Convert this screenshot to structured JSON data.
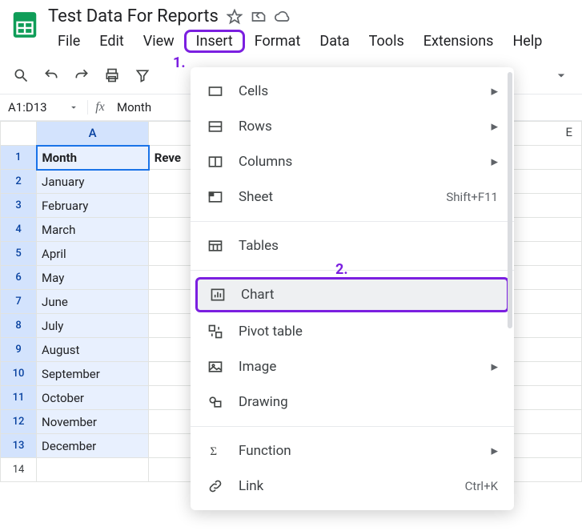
{
  "doc": {
    "title": "Test Data For Reports"
  },
  "menubar": [
    "File",
    "Edit",
    "View",
    "Insert",
    "Format",
    "Data",
    "Tools",
    "Extensions",
    "Help"
  ],
  "active_menu_index": 3,
  "namebox": "A1:D13",
  "formula": "Month",
  "columns": {
    "A": "A",
    "B_truncated": "Reve",
    "E": "E"
  },
  "rows_header": [
    "1",
    "2",
    "3",
    "4",
    "5",
    "6",
    "7",
    "8",
    "9",
    "10",
    "11",
    "12",
    "13",
    "14"
  ],
  "cells": {
    "A": [
      "Month",
      "January",
      "February",
      "March",
      "April",
      "May",
      "June",
      "July",
      "August",
      "September",
      "October",
      "November",
      "December",
      ""
    ],
    "B_visible_header": "Reve"
  },
  "insert_menu": {
    "group1": [
      {
        "icon": "cells",
        "label": "Cells",
        "submenu": true
      },
      {
        "icon": "rows",
        "label": "Rows",
        "submenu": true
      },
      {
        "icon": "columns",
        "label": "Columns",
        "submenu": true
      },
      {
        "icon": "sheet",
        "label": "Sheet",
        "shortcut": "Shift+F11"
      }
    ],
    "group2": [
      {
        "icon": "tables",
        "label": "Tables"
      }
    ],
    "group3": [
      {
        "icon": "chart",
        "label": "Chart",
        "highlight": true
      },
      {
        "icon": "pivot",
        "label": "Pivot table"
      },
      {
        "icon": "image",
        "label": "Image",
        "submenu": true
      },
      {
        "icon": "drawing",
        "label": "Drawing"
      }
    ],
    "group4": [
      {
        "icon": "function",
        "label": "Function",
        "submenu": true
      },
      {
        "icon": "link",
        "label": "Link",
        "shortcut": "Ctrl+K"
      }
    ]
  },
  "annotations": {
    "one": "1.",
    "two": "2."
  }
}
